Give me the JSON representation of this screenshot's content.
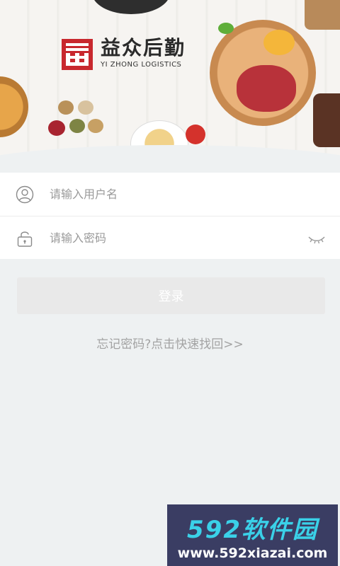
{
  "brand": {
    "name_cn": "益众后勤",
    "name_en": "YI ZHONG LOGISTICS",
    "accent_color": "#c8282e"
  },
  "login_form": {
    "username_placeholder": "请输入用户名",
    "password_placeholder": "请输入密码",
    "username_icon": "user-icon",
    "password_icon": "lock-icon",
    "toggle_icon": "eye-closed-icon"
  },
  "actions": {
    "login_label": "登录",
    "forgot_label": "忘记密码?点击快速找回>>"
  },
  "watermark": {
    "brand": "592软件园",
    "url": "www.592xiazai.com"
  }
}
